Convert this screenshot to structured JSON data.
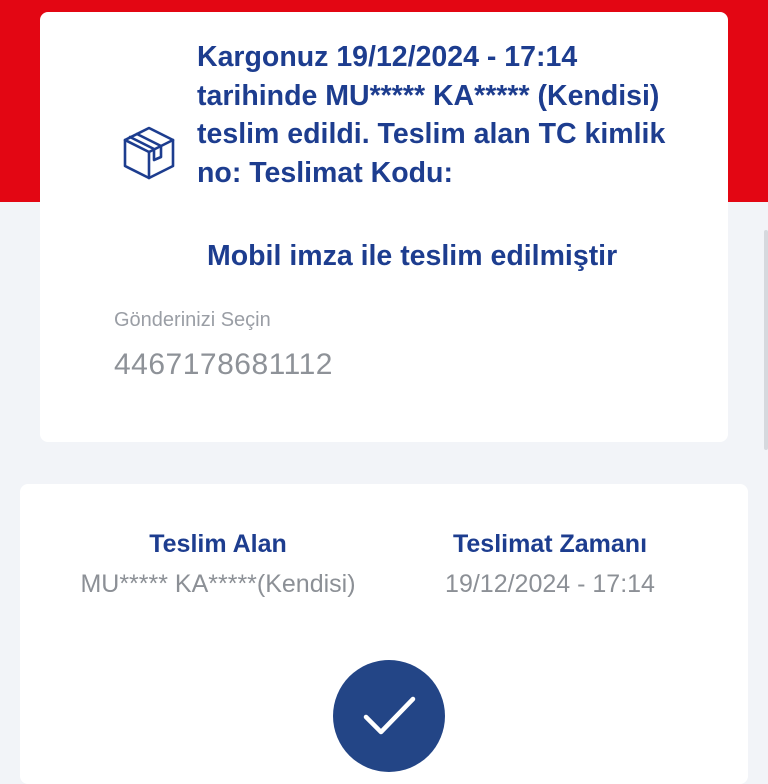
{
  "delivery_card": {
    "status_message": "Kargonuz 19/12/2024 - 17:14 tarihinde MU***** KA***** (Kendisi) teslim edildi. Teslim alan TC kimlik no: Teslimat Kodu:",
    "signature_note": "Mobil imza ile teslim edilmiştir",
    "shipment_select": {
      "label": "Gönderinizi Seçin",
      "value": "4467178681112"
    }
  },
  "details_card": {
    "recipient": {
      "title": "Teslim Alan",
      "value": "MU***** KA*****(Kendisi)"
    },
    "delivery_time": {
      "title": "Teslimat Zamanı",
      "value": "19/12/2024 - 17:14"
    }
  },
  "colors": {
    "brand_red": "#e30613",
    "brand_navy": "#1d3d8f",
    "check_circle": "#234586"
  },
  "icons": {
    "package": "package-icon",
    "status": "checkmark-icon"
  }
}
